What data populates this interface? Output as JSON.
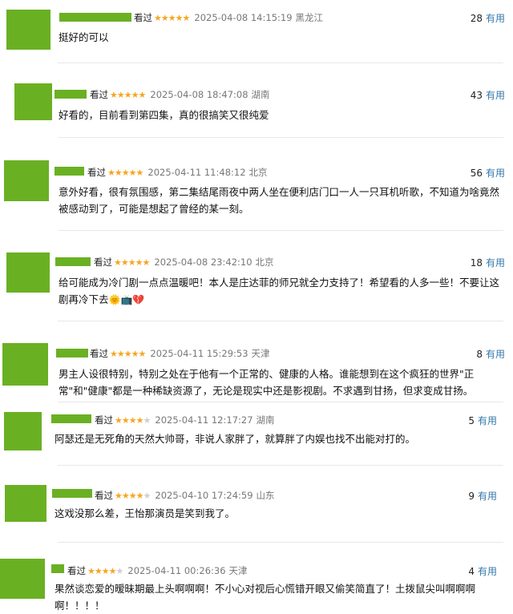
{
  "reviews": [
    {
      "status": "看过",
      "stars": 5,
      "time": "2025-04-08 14:15:19",
      "location": "黑龙江",
      "votes": "28",
      "useful": "有用",
      "content": "挺好的可以",
      "emoji": ""
    },
    {
      "status": "看过",
      "stars": 5,
      "time": "2025-04-08 18:47:08",
      "location": "湖南",
      "votes": "43",
      "useful": "有用",
      "content": "好看的，目前看到第四集，真的很搞笑又很纯爱",
      "emoji": ""
    },
    {
      "status": "看过",
      "stars": 5,
      "time": "2025-04-11 11:48:12",
      "location": "北京",
      "votes": "56",
      "useful": "有用",
      "content": "意外好看，很有氛围感，第二集结尾雨夜中两人坐在便利店门口一人一只耳机听歌，不知道为啥竟然被感动到了，可能是想起了曾经的某一刻。",
      "emoji": ""
    },
    {
      "status": "看过",
      "stars": 5,
      "time": "2025-04-08 23:42:10",
      "location": "北京",
      "votes": "18",
      "useful": "有用",
      "content": "给可能成为冷门剧一点点温暖吧！本人是庄达菲的师兄就全力支持了！希望看的人多一些！不要让这剧再冷下去",
      "emoji": "🌞📺💔"
    },
    {
      "status": "看过",
      "stars": 5,
      "time": "2025-04-11 15:29:53",
      "location": "天津",
      "votes": "8",
      "useful": "有用",
      "content": "男主人设很特别，特别之处在于他有一个正常的、健康的人格。谁能想到在这个疯狂的世界\"正常\"和\"健康\"都是一种稀缺资源了，无论是现实中还是影视剧。不求遇到甘扬，但求变成甘扬。",
      "emoji": ""
    },
    {
      "status": "看过",
      "stars": 4,
      "time": "2025-04-11 12:17:27",
      "location": "湖南",
      "votes": "5",
      "useful": "有用",
      "content": "阿瑟还是无死角的天然大帅哥，非说人家胖了，就算胖了内娱也找不出能对打的。",
      "emoji": ""
    },
    {
      "status": "看过",
      "stars": 4,
      "time": "2025-04-10 17:24:59",
      "location": "山东",
      "votes": "9",
      "useful": "有用",
      "content": "这戏没那么差，王怡那演员是笑到我了。",
      "emoji": ""
    },
    {
      "status": "看过",
      "stars": 4,
      "time": "2025-04-11 00:26:36",
      "location": "天津",
      "votes": "4",
      "useful": "有用",
      "content": "果然谈恋爱的暧昧期最上头啊啊啊！不小心对视后心慌错开眼又偷笑简直了！土拨鼠尖叫啊啊啊啊！！！！",
      "emoji": ""
    }
  ]
}
